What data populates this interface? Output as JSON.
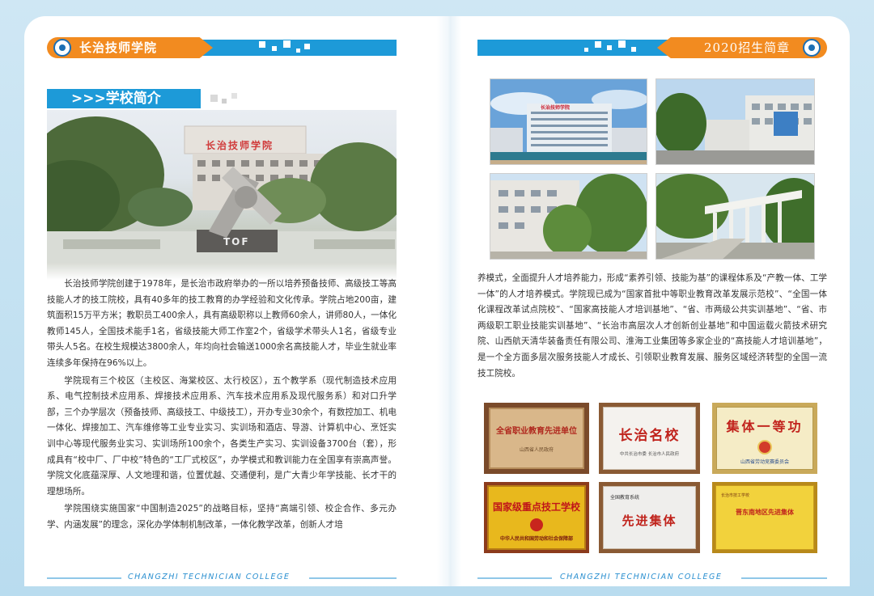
{
  "left_header": {
    "title": "长治技师学院"
  },
  "right_header": {
    "title": "2020招生简章"
  },
  "section": {
    "title": ">>>学校简介"
  },
  "hero_photo": {
    "sign": "长治技师学院",
    "sculpture": "TOF"
  },
  "left_paragraphs": [
    "长治技师学院创建于1978年，是长治市政府举办的一所以培养预备技师、高级技工等高技能人才的技工院校，具有40多年的技工教育的办学经验和文化传承。学院占地200亩，建筑面积15万平方米；教职员工400余人，具有高级职称以上教师60余人，讲师80人，一体化教师145人，全国技术能手1名，省级技能大师工作室2个，省级学术带头人1名，省级专业带头人5名。在校生规模达3800余人，年均向社会输送1000余名高技能人才，毕业生就业率连续多年保持在96%以上。",
    "学院现有三个校区（主校区、海棠校区、太行校区），五个教学系（现代制造技术应用系、电气控制技术应用系、焊接技术应用系、汽车技术应用系及现代服务系）和对口升学部，三个办学层次（预备技师、高级技工、中级技工），开办专业30余个，有数控加工、机电一体化、焊接加工、汽车维修等工业专业实习、实训场和酒店、导游、计算机中心、烹饪实训中心等现代服务业实习、实训场所100余个，各类生产实习、实训设备3700台（套），形成具有“校中厂、厂中校”特色的“工厂式校区”，办学模式和教训能力在全国享有崇高声誉。学院文化底蕴深厚、人文地理和谐，位置优越、交通便利，是广大青少年学技能、长才干的理想场所。",
    "学院围绕实施国家“中国制造2025”的战略目标，坚持“高端引领、校企合作、多元办学、内涵发展”的理念，深化办学体制机制改革，一体化教学改革，创新人才培"
  ],
  "right_paragraph": "养模式，全面提升人才培养能力，形成“素养引领、技能为基”的课程体系及“产教一体、工学一体”的人才培养模式。学院现已成为“国家首批中等职业教育改革发展示范校”、“全国一体化课程改革试点院校”、“国家高技能人才培训基地”、“省、市两级公共实训基地”、“省、市两级职工职业技能实训基地”、“长治市高层次人才创新创业基地”和中国运载火箭技术研究院、山西航天清华装备责任有限公司、淮海工业集团等多家企业的“高技能人才培训基地”，是一个全方面多层次服务技能人才成长、引领职业教育发展、服务区域经济转型的全国一流技工院校。",
  "campus_photo_sign": "长治技师学院",
  "certificates": [
    {
      "title": "全省职业教育先进单位",
      "sub": "山西省人民政府",
      "style": "brown"
    },
    {
      "title": "长治名校",
      "sub": "中共长治市委 长治市人民政府",
      "style": "white-red"
    },
    {
      "title": "集体一等功",
      "sub": "山西省劳动竞赛委员会",
      "style": "gold-red"
    },
    {
      "title": "国家级重点技工学校",
      "sub": "中华人民共和国劳动和社会保障部",
      "style": "yellow-red"
    },
    {
      "title": "先进集体",
      "sub": "全国教育系统",
      "style": "white-red"
    },
    {
      "title": "晋东南地区先进集体",
      "sub": "长治市技工学校",
      "style": "yellow-red-small"
    }
  ],
  "footer": {
    "left": "CHANGZHI TECHNICIAN COLLEGE",
    "right": "CHANGZHI TECHNICIAN COLLEGE"
  },
  "colors": {
    "accent_blue": "#1d9ad8",
    "accent_orange": "#f28b20"
  }
}
